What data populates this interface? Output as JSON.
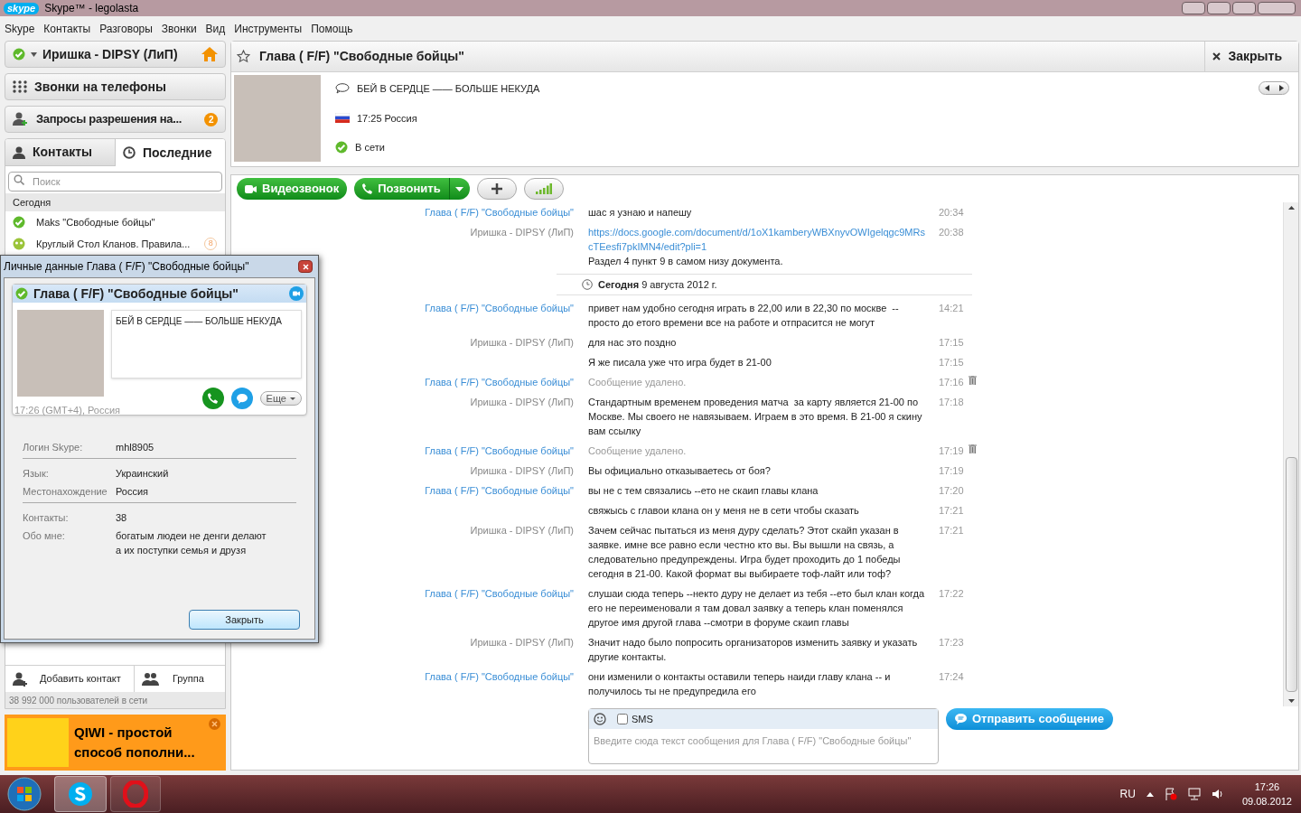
{
  "window": {
    "logo": "skype",
    "title": "Skype™ - legolasta"
  },
  "menu": [
    "Skype",
    "Контакты",
    "Разговоры",
    "Звонки",
    "Вид",
    "Инструменты",
    "Помощь"
  ],
  "sidebar": {
    "profile": {
      "name": "Иришка - DIPSY (ЛиП)"
    },
    "phone_calls": "Звонки на телефоны",
    "requests": {
      "label": "Запросы разрешения на...",
      "badge": "2"
    },
    "tabs": [
      {
        "label": "Контакты",
        "selected": false
      },
      {
        "label": "Последние",
        "selected": true
      }
    ],
    "search": {
      "placeholder": "Поиск"
    },
    "group": "Сегодня",
    "recent": [
      {
        "kind": "contact",
        "name": "Maks \"Свободные бойцы\""
      },
      {
        "kind": "group",
        "name": "Круглый Стол Кланов. Правила...",
        "badge": "8"
      }
    ],
    "add_contact": "Добавить контакт",
    "add_group": "Группа",
    "online_count": "38 992 000 пользователей в сети",
    "ad": {
      "line_1": "QIWI - простой",
      "line_2": "способ пополни..."
    }
  },
  "chat": {
    "title": "Глава ( F/F) \"Свободные бойцы\"",
    "close": "Закрыть",
    "mood": "БЕЙ В СЕРДЦЕ —— БОЛЬШЕ НЕКУДА",
    "local_time": "17:25 Россия",
    "status": "В сети",
    "video_call": "Видеозвонок",
    "call": "Позвонить",
    "messages": [
      {
        "kind": "message",
        "color": "#3a8ed6",
        "sender": "Глава ( F/F) \"Свободные бойцы\"",
        "text": "шас я узнаю и напешу",
        "time": "20:34"
      },
      {
        "kind": "message",
        "color": "#888888",
        "sender": "Иришка - DIPSY (ЛиП)",
        "link": "https://docs.google.com/document/d/1oX1kamberyWBXnyvOWIgelqgc9MRscTEesfi7pkIMN4/edit?pli=1",
        "text": "Раздел 4 пункт 9 в самом низу документа.",
        "time": "20:38"
      },
      {
        "kind": "date",
        "text": "**Сегодня** 9 августа 2012 г."
      },
      {
        "kind": "message",
        "color": "#3a8ed6",
        "sender": "Глава ( F/F) \"Свободные бойцы\"",
        "text": "привет нам удобно сегодня играть в 22,00 или в 22,30 по москве  -- просто до етого времени все на работе и отпрасится не могут",
        "time": "14:21"
      },
      {
        "kind": "message",
        "color": "#888888",
        "sender": "Иришка - DIPSY (ЛиП)",
        "text": "для нас это поздно",
        "time": "17:15"
      },
      {
        "kind": "message",
        "text": "Я же писала уже что игра будет в 21-00",
        "time": "17:15"
      },
      {
        "kind": "message",
        "color": "#3a8ed6",
        "sender": "Глава ( F/F) \"Свободные бойцы\"",
        "text": "Сообщение удалено.",
        "time": "17:16",
        "deleted": true
      },
      {
        "kind": "message",
        "color": "#888888",
        "sender": "Иришка - DIPSY (ЛиП)",
        "text": "Стандартным временем проведения матча  за карту является 21-00 по Москве. Мы своего не навязываем. Играем в это время. В 21-00 я скину вам ссылку",
        "time": "17:18"
      },
      {
        "kind": "message",
        "color": "#3a8ed6",
        "sender": "Глава ( F/F) \"Свободные бойцы\"",
        "text": "Сообщение удалено.",
        "time": "17:19",
        "deleted": true
      },
      {
        "kind": "message",
        "color": "#888888",
        "sender": "Иришка - DIPSY (ЛиП)",
        "text": "Вы официально отказываетесь от боя?",
        "time": "17:19"
      },
      {
        "kind": "message",
        "color": "#3a8ed6",
        "sender": "Глава ( F/F) \"Свободные бойцы\"",
        "text": "вы не с тем связались --ето не скаип главы клана",
        "time": "17:20"
      },
      {
        "kind": "message",
        "text": "свяжысь с главои клана он у меня не в сети чтобы сказать",
        "time": "17:21"
      },
      {
        "kind": "message",
        "color": "#888888",
        "sender": "Иришка - DIPSY (ЛиП)",
        "text": "Зачем сейчас пытаться из меня дуру сделать? Этот скайп указан в заявке. имне все равно если честно кто вы. Вы вышли на связь, а следовательно предупреждены. Игра будет проходить до 1 победы сегодня в 21-00. Какой формат вы выбираете тоф-лайт или тоф?",
        "time": "17:21"
      },
      {
        "kind": "message",
        "color": "#3a8ed6",
        "sender": "Глава ( F/F) \"Свободные бойцы\"",
        "text": "слушаи сюда теперь --некто дуру не делает из тебя --ето был клан когда его не переименовали я там довал заявку а теперь клан поменялся другое имя другой глава --смотри в форуме скаип главы",
        "time": "17:22"
      },
      {
        "kind": "message",
        "color": "#888888",
        "sender": "Иришка - DIPSY (ЛиП)",
        "text": "Значит надо было попросить организаторов изменить заявку и указать другие контакты.",
        "time": "17:23"
      },
      {
        "kind": "message",
        "color": "#3a8ed6",
        "sender": "Глава ( F/F) \"Свободные бойцы\"",
        "text": "они изменили о контакты оставили теперь наиди главу клана -- и получилось ты не предупредила его",
        "time": "17:24"
      }
    ],
    "composer": {
      "sms_label": "SMS",
      "sms_checked": false,
      "placeholder": "Введите сюда текст сообщения для Глава ( F/F) \"Свободные бойцы\"",
      "send": "Отправить сообщение"
    }
  },
  "dialog": {
    "title": "Личные данные Глава ( F/F) \"Свободные бойцы\"",
    "name": "Глава ( F/F) \"Свободные бойцы\"",
    "mood": "БЕЙ В СЕРДЦЕ —— БОЛЬШЕ НЕКУДА",
    "local_time": "17:26 (GMT+4), Россия",
    "more": "Еще",
    "sections": [
      [
        {
          "label": "Логин Skype:",
          "value": "mhl8905"
        }
      ],
      [
        {
          "label": "Язык:",
          "value": "Украинский"
        },
        {
          "label": "Местонахождение",
          "value": "Россия"
        }
      ],
      [
        {
          "label": "Контакты:",
          "value": "38"
        },
        {
          "label": "Обо мне:",
          "value": "богатым людеи не денги делают\nа их поступки семья и друзя"
        }
      ]
    ],
    "close": "Закрыть"
  },
  "taskbar": {
    "language": "RU",
    "time": "17:26",
    "date": "09.08.2012"
  }
}
